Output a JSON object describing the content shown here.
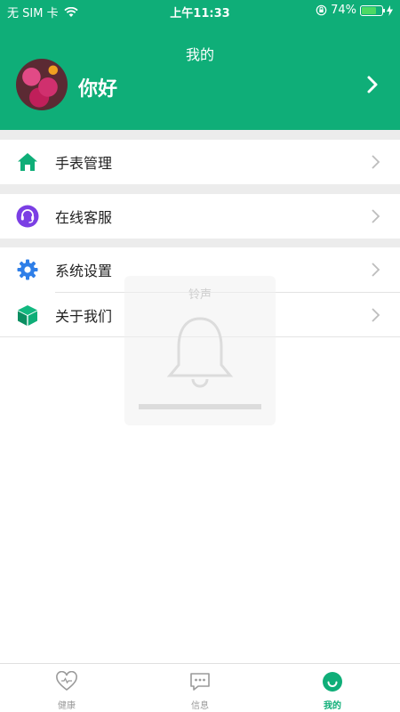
{
  "status_bar": {
    "carrier": "无 SIM 卡",
    "time": "上午11:33",
    "battery_percent": "74%",
    "battery_level": 0.74
  },
  "header": {
    "title": "我的",
    "greeting": "你好"
  },
  "menu": {
    "watch_management": "手表管理",
    "online_service": "在线客服",
    "system_settings": "系统设置",
    "about_us": "关于我们"
  },
  "watermark": {
    "label": "铃声"
  },
  "tabs": {
    "health": "健康",
    "messages": "信息",
    "mine": "我的"
  },
  "colors": {
    "brand": "#0fae78",
    "service_icon": "#7b3fe4",
    "settings_icon": "#2f7fe8"
  }
}
